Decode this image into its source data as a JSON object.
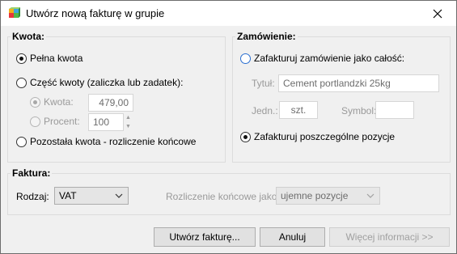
{
  "window": {
    "title": "Utwórz nową fakturę w grupie",
    "icon": "invoice-app-icon",
    "close_icon": "close-icon"
  },
  "kwota": {
    "group_title": "Kwota:",
    "pelna_label": "Pełna kwota",
    "czesc_label": "Część kwoty (zaliczka lub zadatek):",
    "kwota_label": "Kwota:",
    "kwota_value": "479,00",
    "procent_label": "Procent:",
    "procent_value": "100",
    "pozostala_label": "Pozostała kwota - rozliczenie końcowe",
    "selected": "pelna"
  },
  "zamowienie": {
    "group_title": "Zamówienie:",
    "calosc_label": "Zafakturuj zamówienie jako całość:",
    "tytul_label": "Tytuł:",
    "tytul_value": "Cement portlandzki 25kg",
    "jedn_label": "Jedn.:",
    "jedn_value": "szt.",
    "symbol_label": "Symbol:",
    "symbol_value": "",
    "pozycje_label": "Zafakturuj poszczególne pozycje",
    "selected": "pozycje"
  },
  "faktura": {
    "group_title": "Faktura:",
    "rodzaj_label": "Rodzaj:",
    "rodzaj_value": "VAT",
    "rozliczenie_label": "Rozliczenie końcowe jako:",
    "rozliczenie_value": "ujemne pozycje"
  },
  "buttons": {
    "create": "Utwórz fakturę...",
    "cancel": "Anuluj",
    "more": "Więcej informacji >>"
  },
  "colors": {
    "accent": "#2a6fd0",
    "disabled_text": "#9a9a9a"
  }
}
